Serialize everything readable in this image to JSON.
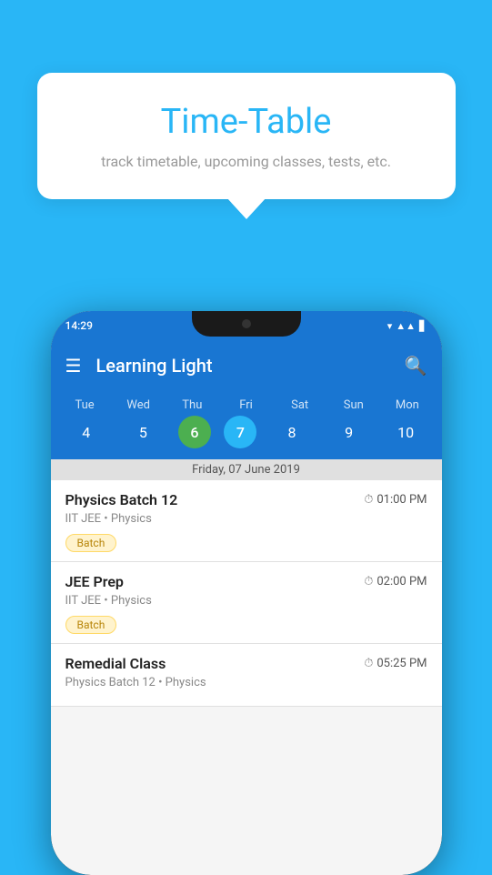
{
  "background_color": "#29b6f6",
  "tooltip": {
    "title": "Time-Table",
    "subtitle": "track timetable, upcoming classes, tests, etc."
  },
  "phone": {
    "status_bar": {
      "time": "14:29",
      "icons": [
        "▾▴",
        "▲▲",
        "▋"
      ]
    },
    "app_bar": {
      "menu_icon": "☰",
      "title": "Learning Light",
      "search_icon": "🔍"
    },
    "calendar": {
      "days": [
        "Tue",
        "Wed",
        "Thu",
        "Fri",
        "Sat",
        "Sun",
        "Mon"
      ],
      "dates": [
        "4",
        "5",
        "6",
        "7",
        "8",
        "9",
        "10"
      ],
      "today_index": 2,
      "selected_index": 3,
      "selected_date_label": "Friday, 07 June 2019"
    },
    "schedule": [
      {
        "name": "Physics Batch 12",
        "time": "01:00 PM",
        "info": "IIT JEE • Physics",
        "badge": "Batch"
      },
      {
        "name": "JEE Prep",
        "time": "02:00 PM",
        "info": "IIT JEE • Physics",
        "badge": "Batch"
      },
      {
        "name": "Remedial Class",
        "time": "05:25 PM",
        "info": "Physics Batch 12 • Physics",
        "badge": null
      }
    ]
  }
}
